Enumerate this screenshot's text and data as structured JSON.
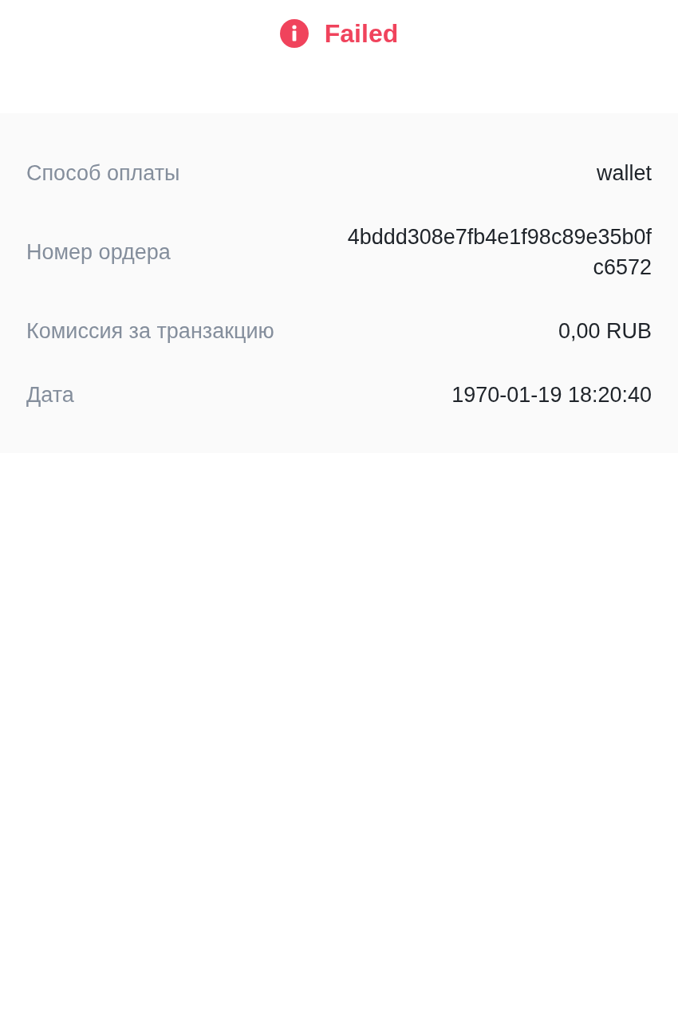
{
  "status": {
    "kind": "failed",
    "label": "Failed"
  },
  "details": [
    {
      "label": "Способ оплаты",
      "value": "wallet"
    },
    {
      "label": "Номер ордера",
      "value": "4bddd308e7fb4e1f98c89e35b0fc6572"
    },
    {
      "label": "Комиссия за транзакцию",
      "value": "0,00 RUB"
    },
    {
      "label": "Дата",
      "value": "1970-01-19 18:20:40"
    }
  ]
}
